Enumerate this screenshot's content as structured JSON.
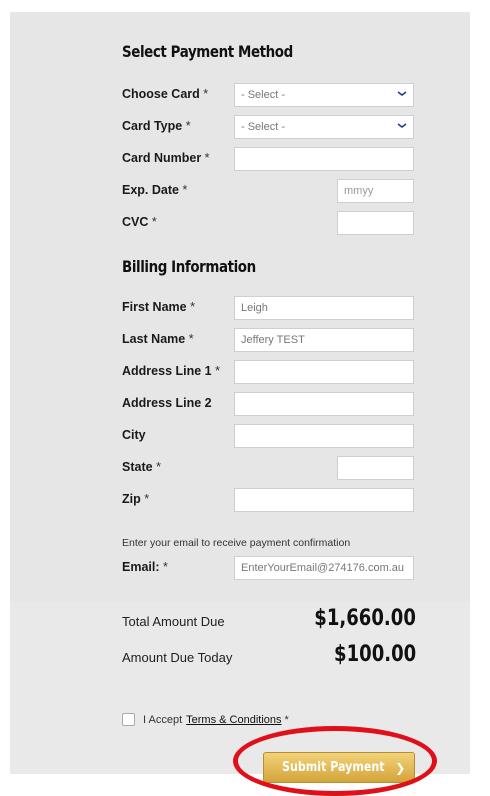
{
  "payment": {
    "title": "Select Payment Method",
    "choose_card": {
      "label": "Choose Card",
      "value": "- Select -"
    },
    "card_type": {
      "label": "Card Type",
      "value": "- Select -"
    },
    "card_number": {
      "label": "Card Number",
      "value": ""
    },
    "exp_date": {
      "label": "Exp. Date",
      "placeholder": "mmyy"
    },
    "cvc": {
      "label": "CVC",
      "value": ""
    }
  },
  "billing": {
    "title": "Billing Information",
    "first_name": {
      "label": "First Name",
      "value": "Leigh"
    },
    "last_name": {
      "label": "Last Name",
      "value": "Jeffery TEST"
    },
    "address1": {
      "label": "Address Line 1",
      "value": ""
    },
    "address2": {
      "label": "Address Line 2",
      "value": ""
    },
    "city": {
      "label": "City",
      "value": ""
    },
    "state": {
      "label": "State",
      "value": ""
    },
    "zip": {
      "label": "Zip",
      "value": ""
    },
    "email_note": "Enter your email to receive payment confirmation",
    "email": {
      "label": "Email:",
      "value": "EnterYourEmail@274176.com.au"
    }
  },
  "required_marker": "*",
  "totals": {
    "total_label": "Total Amount Due",
    "total_value": "$1,660.00",
    "today_label": "Amount Due Today",
    "today_value": "$100.00"
  },
  "terms": {
    "prefix": "I Accept",
    "link": "Terms & Conditions",
    "required": "*",
    "checked": false
  },
  "submit": {
    "label": "Submit Payment",
    "icon": "chevron-right-icon"
  },
  "colors": {
    "submit_gold": "#d9aa3f",
    "highlight_red": "#e0101a"
  }
}
